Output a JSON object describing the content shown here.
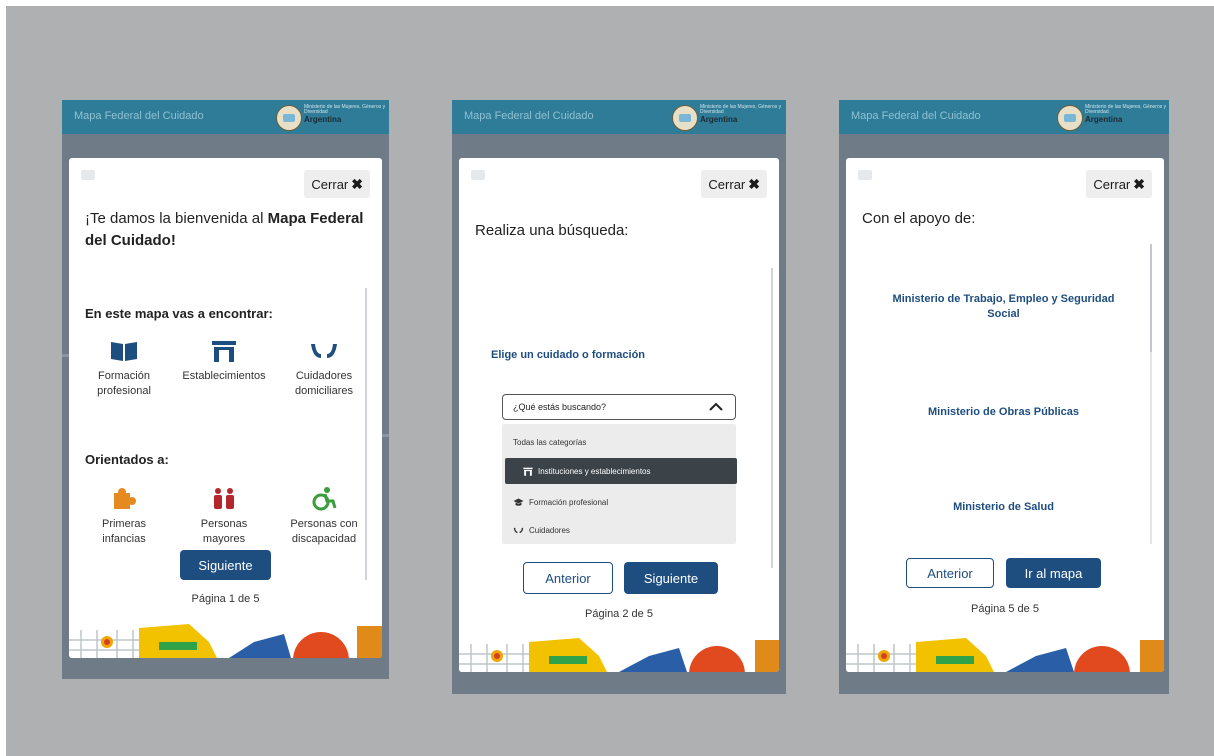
{
  "app": {
    "title": "Mapa Federal del Cuidado",
    "ministry_small": "Ministerio de las Mujeres, Géneros y Diversidad",
    "ministry_big": "Argentina"
  },
  "colors": {
    "header": "#2f7c98",
    "primary": "#1e4d80",
    "background": "#afb0b2"
  },
  "screens": [
    {
      "close_label": "Cerrar",
      "title_normal": "¡Te damos la bienvenida al ",
      "title_bold": "Mapa Federal del Cuidado!",
      "section1": "En este mapa vas a encontrar:",
      "features": [
        {
          "label": "Formación profesional",
          "icon": "book-icon"
        },
        {
          "label": "Establecimientos",
          "icon": "building-icon"
        },
        {
          "label": "Cuidadores domiciliares",
          "icon": "hands-icon"
        }
      ],
      "section2": "Orientados a:",
      "audiences": [
        {
          "label": "Primeras infancias",
          "icon": "puzzle-icon"
        },
        {
          "label": "Personas mayores",
          "icon": "people-icon"
        },
        {
          "label": "Personas con discapacidad",
          "icon": "wheelchair-icon"
        }
      ],
      "next_label": "Siguiente",
      "pager": "Página 1 de 5"
    },
    {
      "close_label": "Cerrar",
      "title": "Realiza una búsqueda:",
      "prompt": "Elige un cuidado o formación",
      "dropdown_placeholder": "¿Qué estás buscando?",
      "options": [
        {
          "label": "Todas las categorías",
          "icon": ""
        },
        {
          "label": "Instituciones y establecimientos",
          "icon": "building-icon"
        },
        {
          "label": "Formación profesional",
          "icon": "graduation-icon"
        },
        {
          "label": "Cuidadores",
          "icon": "hands-icon"
        }
      ],
      "prev_label": "Anterior",
      "next_label": "Siguiente",
      "pager": "Página 2 de 5"
    },
    {
      "close_label": "Cerrar",
      "title": "Con el apoyo de:",
      "supporters": [
        "Ministerio de Trabajo, Empleo y Seguridad Social",
        "Ministerio de Obras Públicas",
        "Ministerio de Salud"
      ],
      "prev_label": "Anterior",
      "map_label": "Ir al mapa",
      "pager": "Página 5 de 5"
    }
  ]
}
